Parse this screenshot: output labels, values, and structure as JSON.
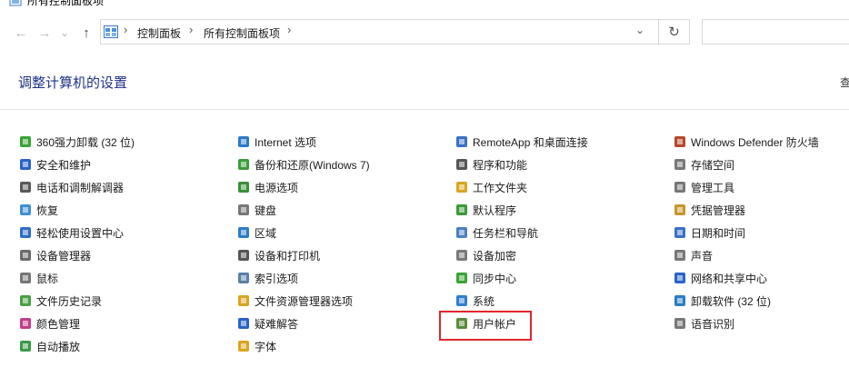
{
  "window": {
    "title": "所有控制面板项"
  },
  "nav": {
    "back_glyph": "←",
    "forward_glyph": "→",
    "history_glyph": "⌄",
    "up_glyph": "↑",
    "breadcrumb": [
      "控制面板",
      "所有控制面板项"
    ],
    "refresh_glyph": "↻",
    "dropdown_glyph": "⌄"
  },
  "header": {
    "title": "调整计算机的设置",
    "view_by_partial": "查"
  },
  "columns": [
    [
      {
        "label": "360强力卸载 (32 位)",
        "icon": "uninstall-tool-icon",
        "color": "#3aa336"
      },
      {
        "label": "安全和维护",
        "icon": "flag-icon",
        "color": "#2b62c9"
      },
      {
        "label": "电话和调制解调器",
        "icon": "modem-icon",
        "color": "#5a5a5a"
      },
      {
        "label": "恢复",
        "icon": "recovery-icon",
        "color": "#3f8fd1"
      },
      {
        "label": "轻松使用设置中心",
        "icon": "ease-of-access-icon",
        "color": "#2b6fc7"
      },
      {
        "label": "设备管理器",
        "icon": "device-manager-icon",
        "color": "#6b6b6b"
      },
      {
        "label": "鼠标",
        "icon": "mouse-icon",
        "color": "#777777"
      },
      {
        "label": "文件历史记录",
        "icon": "file-history-icon",
        "color": "#4aa043"
      },
      {
        "label": "颜色管理",
        "icon": "color-management-icon",
        "color": "#c33d8a"
      },
      {
        "label": "自动播放",
        "icon": "autoplay-icon",
        "color": "#3b9b47"
      }
    ],
    [
      {
        "label": "Internet 选项",
        "icon": "internet-options-icon",
        "color": "#2d79c7"
      },
      {
        "label": "备份和还原(Windows 7)",
        "icon": "backup-restore-icon",
        "color": "#3c9c3c"
      },
      {
        "label": "电源选项",
        "icon": "power-options-icon",
        "color": "#3a8f3a"
      },
      {
        "label": "键盘",
        "icon": "keyboard-icon",
        "color": "#777777"
      },
      {
        "label": "区域",
        "icon": "region-icon",
        "color": "#2b7cc5"
      },
      {
        "label": "设备和打印机",
        "icon": "printer-icon",
        "color": "#555555"
      },
      {
        "label": "索引选项",
        "icon": "indexing-icon",
        "color": "#5b7fa8"
      },
      {
        "label": "文件资源管理器选项",
        "icon": "folder-options-icon",
        "color": "#d9a520"
      },
      {
        "label": "疑难解答",
        "icon": "troubleshooting-icon",
        "color": "#2b62c9"
      },
      {
        "label": "字体",
        "icon": "fonts-icon",
        "color": "#d9a520"
      }
    ],
    [
      {
        "label": "RemoteApp 和桌面连接",
        "icon": "remote-desktop-icon",
        "color": "#3a6fc4"
      },
      {
        "label": "程序和功能",
        "icon": "programs-features-icon",
        "color": "#555555"
      },
      {
        "label": "工作文件夹",
        "icon": "work-folders-icon",
        "color": "#d9a520"
      },
      {
        "label": "默认程序",
        "icon": "default-programs-icon",
        "color": "#3a9a3a"
      },
      {
        "label": "任务栏和导航",
        "icon": "taskbar-icon",
        "color": "#4a7fc0"
      },
      {
        "label": "设备加密",
        "icon": "device-encryption-icon",
        "color": "#7a7a7a"
      },
      {
        "label": "同步中心",
        "icon": "sync-center-icon",
        "color": "#3aa336"
      },
      {
        "label": "系统",
        "icon": "system-icon",
        "color": "#2f7fce"
      },
      {
        "label": "用户帐户",
        "icon": "user-accounts-icon",
        "color": "#5a8a3a"
      }
    ],
    [
      {
        "label": "Windows Defender 防火墙",
        "icon": "firewall-icon",
        "color": "#b5482c"
      },
      {
        "label": "存储空间",
        "icon": "storage-spaces-icon",
        "color": "#777777"
      },
      {
        "label": "管理工具",
        "icon": "admin-tools-icon",
        "color": "#777777"
      },
      {
        "label": "凭据管理器",
        "icon": "credential-manager-icon",
        "color": "#c8962a"
      },
      {
        "label": "日期和时间",
        "icon": "date-time-icon",
        "color": "#3a6fc4"
      },
      {
        "label": "声音",
        "icon": "sound-icon",
        "color": "#777777"
      },
      {
        "label": "网络和共享中心",
        "icon": "network-icon",
        "color": "#2b62c9"
      },
      {
        "label": "卸载软件 (32 位)",
        "icon": "uninstall-software-icon",
        "color": "#2b7cc5"
      },
      {
        "label": "语音识别",
        "icon": "microphone-icon",
        "color": "#777777"
      }
    ]
  ],
  "highlight": {
    "label_ref": "用户帐户",
    "color": "#e0262c"
  }
}
